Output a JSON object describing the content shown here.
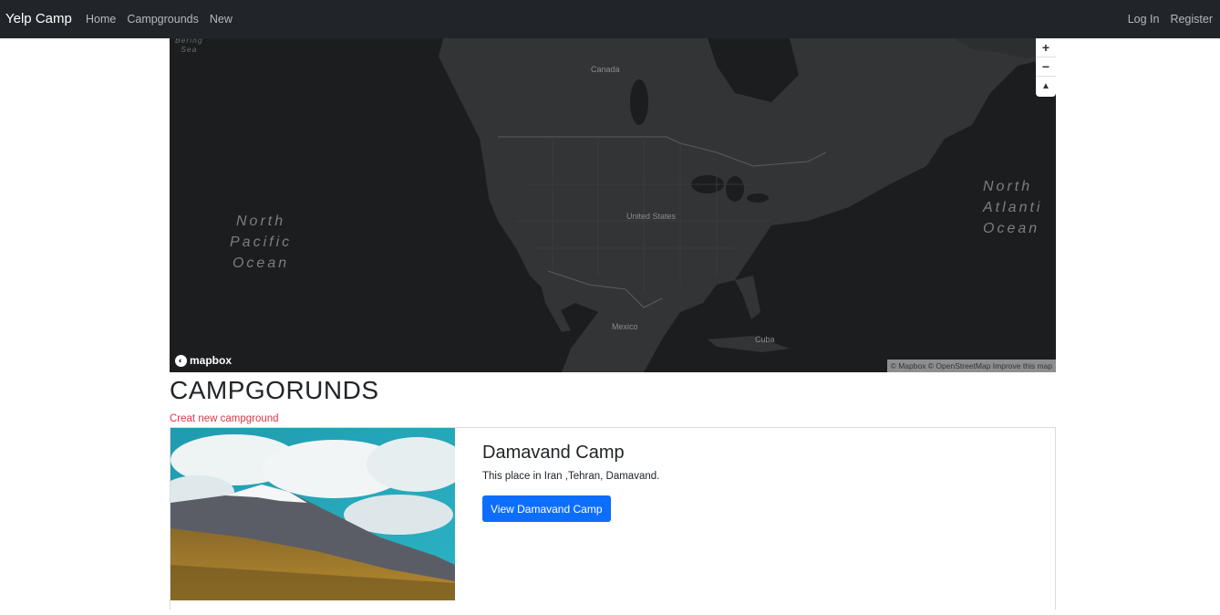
{
  "navbar": {
    "brand": "Yelp Camp",
    "links": [
      "Home",
      "Campgrounds",
      "New"
    ],
    "auth": [
      "Log In",
      "Register"
    ]
  },
  "map": {
    "labels": {
      "canada": "Canada",
      "united_states": "United States",
      "mexico": "Mexico",
      "cuba": "Cuba",
      "north_pacific": "North\nPacific\nOcean",
      "north_atlantic": "North\nAtlanti\nOcean",
      "bering_sea": "Bering\nSea"
    },
    "controls": {
      "zoom_in": "+",
      "zoom_out": "−",
      "compass": "▲"
    },
    "logo": "mapbox",
    "attribution": "© Mapbox © OpenStreetMap Improve this map"
  },
  "main": {
    "heading": "CAMPGORUNDS",
    "create_link": "Creat new campground",
    "campgrounds": [
      {
        "title": "Damavand Camp",
        "description": "This place in Iran ,Tehran, Damavand.",
        "button": "View Damavand Camp"
      }
    ]
  }
}
